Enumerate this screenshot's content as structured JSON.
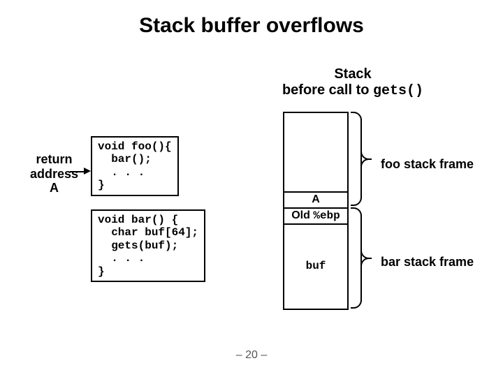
{
  "title": "Stack buffer overflows",
  "subtitle_line1": "Stack",
  "subtitle_line2_a": "before call to ",
  "subtitle_line2_b": "gets()",
  "return_label_l1": "return",
  "return_label_l2": "address",
  "return_label_l3": "A",
  "code_foo": "void foo(){\n  bar();\n  . . .\n}",
  "code_bar": "void bar() {\n  char buf[64];\n  gets(buf);\n  . . .\n}",
  "stack": {
    "cell_a": "A",
    "cell_old_ebp_prefix": "Old ",
    "cell_old_ebp_reg": "%ebp",
    "cell_buf": "buf"
  },
  "foo_frame_label": "foo stack frame",
  "bar_frame_label": "bar stack frame",
  "page_number": "– 20 –"
}
